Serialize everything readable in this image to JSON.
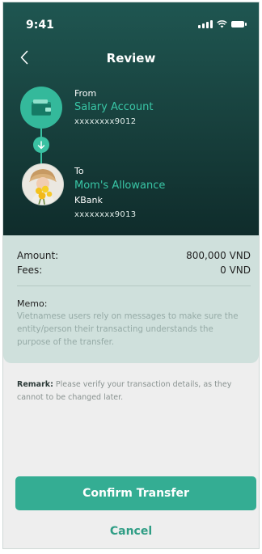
{
  "status_bar": {
    "time": "9:41"
  },
  "header": {
    "title": "Review"
  },
  "from": {
    "label": "From",
    "account_name": "Salary Account",
    "account_number": "xxxxxxxx9012"
  },
  "to": {
    "label": "To",
    "account_name": "Mom's Allowance",
    "bank": "KBank",
    "account_number": "xxxxxxxx9013"
  },
  "summary": {
    "amount_label": "Amount:",
    "amount_value": "800,000 VND",
    "fees_label": "Fees:",
    "fees_value": "0 VND",
    "memo_label": "Memo:",
    "memo_text": "Vietnamese users rely on messages to make sure the entity/person their transacting understands the purpose of the transfer."
  },
  "remark": {
    "label": "Remark:",
    "text": "Please verify your transaction details, as they cannot to be changed later."
  },
  "actions": {
    "confirm_label": "Confirm Transfer",
    "cancel_label": "Cancel"
  },
  "colors": {
    "accent": "#34ad93",
    "hero_dark": "#173f3c",
    "summary_bg": "#cfe0dc"
  }
}
